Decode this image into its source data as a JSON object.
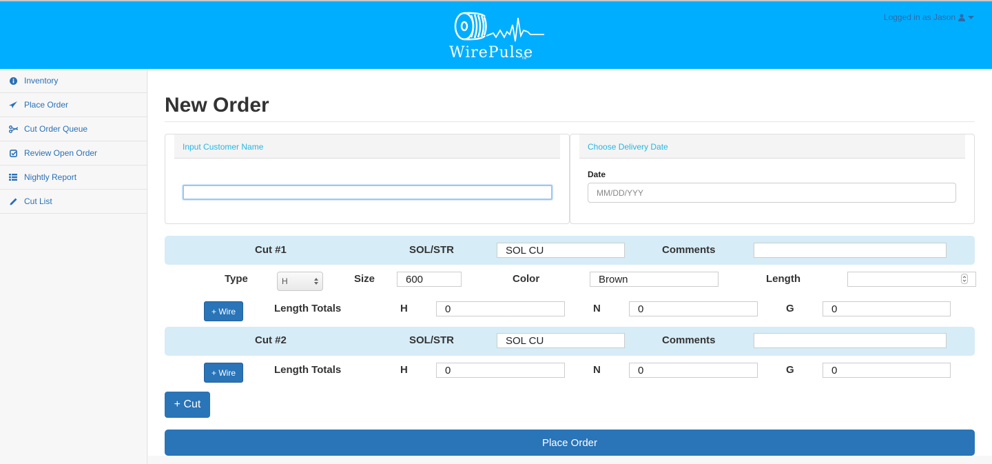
{
  "header": {
    "brand": "WirePulse",
    "trademark": "TM",
    "user_label": "Logged in as Jason",
    "brand_color": "#00aeff"
  },
  "sidebar": {
    "items": [
      {
        "label": "Inventory",
        "icon": "info-circle-icon"
      },
      {
        "label": "Place Order",
        "icon": "paper-plane-icon"
      },
      {
        "label": "Cut Order Queue",
        "icon": "scissors-icon"
      },
      {
        "label": "Review Open Order",
        "icon": "check-square-icon"
      },
      {
        "label": "Nightly Report",
        "icon": "list-icon"
      },
      {
        "label": "Cut List",
        "icon": "pencil-icon"
      }
    ]
  },
  "main": {
    "title": "New Order",
    "customer_panel": {
      "heading": "Input Customer Name",
      "value": ""
    },
    "date_panel": {
      "heading": "Choose Delivery Date",
      "label": "Date",
      "placeholder": "MM/DD/YYY",
      "value": ""
    },
    "cuts": [
      {
        "title": "Cut #1",
        "sol_str_label": "SOL/STR",
        "sol_str_value": "SOL CU",
        "comments_label": "Comments",
        "comments_value": "",
        "wire": {
          "type_label": "Type",
          "type_value": "H",
          "size_label": "Size",
          "size_value": "600",
          "color_label": "Color",
          "color_value": "Brown",
          "length_label": "Length",
          "length_value": ""
        },
        "add_wire_label": "+ Wire",
        "totals_label": "Length Totals",
        "totals": [
          {
            "label": "H",
            "value": "0"
          },
          {
            "label": "N",
            "value": "0"
          },
          {
            "label": "G",
            "value": "0"
          }
        ]
      },
      {
        "title": "Cut #2",
        "sol_str_label": "SOL/STR",
        "sol_str_value": "SOL CU",
        "comments_label": "Comments",
        "comments_value": "",
        "add_wire_label": "+ Wire",
        "totals_label": "Length Totals",
        "totals": [
          {
            "label": "H",
            "value": "0"
          },
          {
            "label": "N",
            "value": "0"
          },
          {
            "label": "G",
            "value": "0"
          }
        ]
      }
    ],
    "add_cut_label": "+ Cut",
    "place_order_label": "Place Order"
  }
}
